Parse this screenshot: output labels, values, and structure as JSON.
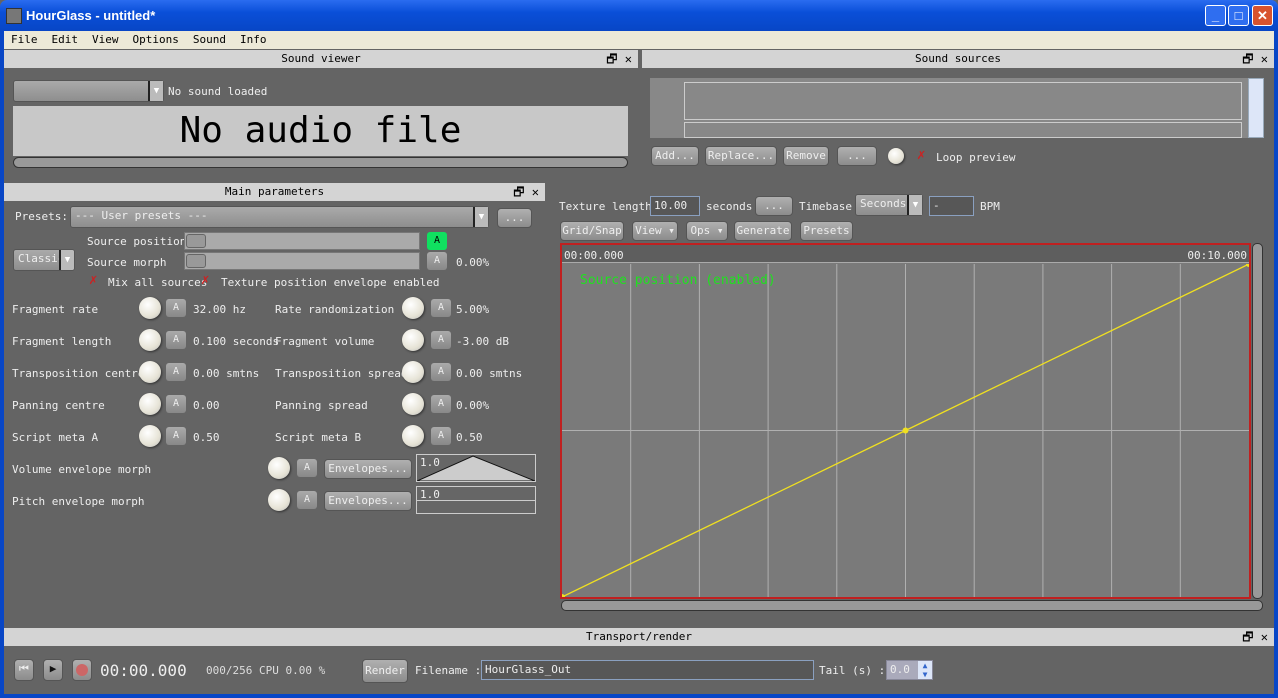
{
  "window": {
    "title": "HourGlass - untitled*",
    "min": "_",
    "max": "□",
    "close": "✕"
  },
  "menu": [
    "File",
    "Edit",
    "View",
    "Options",
    "Sound",
    "Info"
  ],
  "sound_viewer": {
    "title": "Sound viewer",
    "status": "No sound loaded",
    "placeholder": "No audio file"
  },
  "sound_sources": {
    "title": "Sound sources",
    "buttons": [
      "Add...",
      "Replace...",
      "Remove",
      "..."
    ],
    "loop_preview": "Loop preview"
  },
  "main": {
    "title": "Main parameters",
    "presets_label": "Presets:",
    "presets_value": "--- User presets ---",
    "presets_more": "...",
    "mode": "Classic",
    "source_position": "Source position",
    "source_morph": "Source morph",
    "source_morph_value": "0.00%",
    "auto": "A",
    "mix_all": "Mix all sources",
    "texture_env": "Texture position envelope enabled",
    "params_left": [
      {
        "label": "Fragment rate",
        "value": "32.00 hz"
      },
      {
        "label": "Fragment length",
        "value": "0.100 seconds"
      },
      {
        "label": "Transposition centre",
        "value": "0.00 smtns"
      },
      {
        "label": "Panning centre",
        "value": "0.00"
      },
      {
        "label": "Script meta A",
        "value": "0.50"
      }
    ],
    "params_right": [
      {
        "label": "Rate randomization",
        "value": "5.00%"
      },
      {
        "label": "Fragment volume",
        "value": "-3.00 dB"
      },
      {
        "label": "Transposition spread",
        "value": "0.00 smtns"
      },
      {
        "label": "Panning spread",
        "value": "0.00%"
      },
      {
        "label": "Script meta B",
        "value": "0.50"
      }
    ],
    "env_rows": [
      {
        "label": "Volume envelope morph",
        "button": "Envelopes...",
        "preview": "1.0"
      },
      {
        "label": "Pitch envelope morph",
        "button": "Envelopes...",
        "preview": "1.0"
      }
    ]
  },
  "texture": {
    "length_label": "Texture length",
    "length_value": "10.00",
    "unit": "seconds",
    "unit_btn": "...",
    "timebase_label": "Timebase",
    "timebase_value": "Seconds",
    "bpm_value": "-",
    "bpm_label": "BPM",
    "buttons": [
      "Grid/Snap",
      "View",
      "Ops",
      "Generate",
      "Presets"
    ],
    "time_start": "00:00.000",
    "time_end": "00:10.000",
    "envelope_label": "Source position (enabled)",
    "points": [
      [
        0,
        0
      ],
      [
        5,
        0.5
      ],
      [
        10,
        1
      ]
    ],
    "colors": {
      "line": "#f0e020",
      "label": "#20e020",
      "border": "#c02020"
    }
  },
  "transport": {
    "title": "Transport/render",
    "time": "00:00.000",
    "cpu": "000/256 CPU 0.00 %",
    "render": "Render",
    "filename_label": "Filename :",
    "filename": "HourGlass_Out",
    "tail_label": "Tail (s) :",
    "tail_value": "0.0"
  }
}
